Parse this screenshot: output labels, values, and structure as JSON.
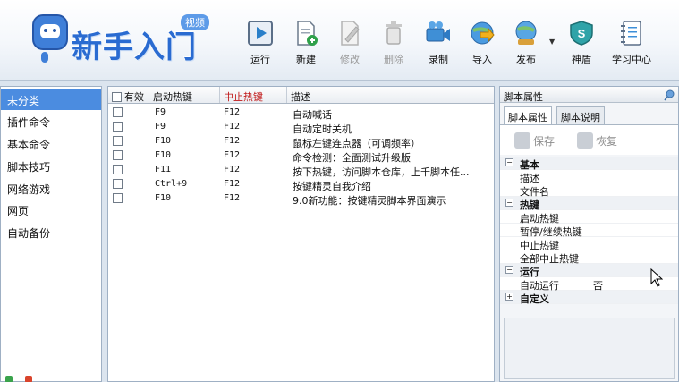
{
  "logo": {
    "text": "新手入门",
    "badge": "视频"
  },
  "toolbar": {
    "run": "运行",
    "new": "新建",
    "edit": "修改",
    "delete": "删除",
    "record": "录制",
    "import": "导入",
    "publish": "发布",
    "shield": "神盾",
    "learn": "学习中心"
  },
  "categories": [
    "未分类",
    "插件命令",
    "基本命令",
    "脚本技巧",
    "网络游戏",
    "网页",
    "自动备份"
  ],
  "list": {
    "headers": {
      "enabled": "有效",
      "start_hotkey": "启动热键",
      "stop_hotkey": "中止热键",
      "desc": "描述"
    },
    "rows": [
      {
        "start": "F9",
        "stop": "F12",
        "desc": "自动喊话"
      },
      {
        "start": "F9",
        "stop": "F12",
        "desc": "自动定时关机"
      },
      {
        "start": "F10",
        "stop": "F12",
        "desc": "鼠标左键连点器（可调频率）"
      },
      {
        "start": "F10",
        "stop": "F12",
        "desc": "命令检测：全面测试升级版"
      },
      {
        "start": "F11",
        "stop": "F12",
        "desc": "按下热键，访问脚本仓库，上千脚本任..."
      },
      {
        "start": "Ctrl+9",
        "stop": "F12",
        "desc": "按键精灵自我介绍"
      },
      {
        "start": "F10",
        "stop": "F12",
        "desc": "9.0新功能：按键精灵脚本界面演示"
      }
    ]
  },
  "props": {
    "title": "脚本属性",
    "tabs": [
      "脚本属性",
      "脚本说明"
    ],
    "save": "保存",
    "restore": "恢复",
    "cat_basic": "基本",
    "desc": "描述",
    "filename": "文件名",
    "cat_hotkey": "热键",
    "start_hotkey": "启动热键",
    "pause_hotkey": "暂停/继续热键",
    "stop_hotkey": "中止热键",
    "stop_all_hotkey": "全部中止热键",
    "cat_run": "运行",
    "auto_run": "自动运行",
    "auto_run_value": "否",
    "cat_custom": "自定义"
  }
}
